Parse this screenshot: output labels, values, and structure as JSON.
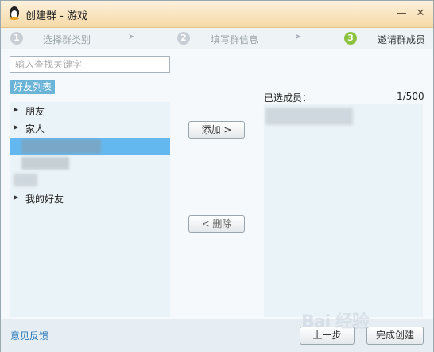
{
  "window": {
    "title": "创建群 - 游戏",
    "minimize_glyph": "—",
    "close_glyph": "✕"
  },
  "steps": [
    {
      "number": "1",
      "label": "选择群类别"
    },
    {
      "number": "2",
      "label": "填写群信息"
    },
    {
      "number": "3",
      "label": "邀请群成员"
    }
  ],
  "step_arrow": "➤",
  "search": {
    "placeholder": "输入查找关键字",
    "value": ""
  },
  "friends_tab": "好友列表",
  "groups": [
    {
      "caret": "▶",
      "label": "朋友"
    },
    {
      "caret": "▶",
      "label": "家人"
    },
    {
      "caret": "▶",
      "label": "我的好友"
    }
  ],
  "buttons": {
    "add": "添加 >",
    "remove": "< 删除"
  },
  "selected": {
    "label": "已选成员：",
    "count": "1/500"
  },
  "footer": {
    "feedback": "意见反馈",
    "prev": "上一步",
    "done": "完成创建"
  },
  "watermark": "Bai 经验",
  "colors": {
    "active_step": "#8cc240",
    "selection": "#64b8f0",
    "tab": "#6ab4d8",
    "link": "#2a77b8"
  }
}
